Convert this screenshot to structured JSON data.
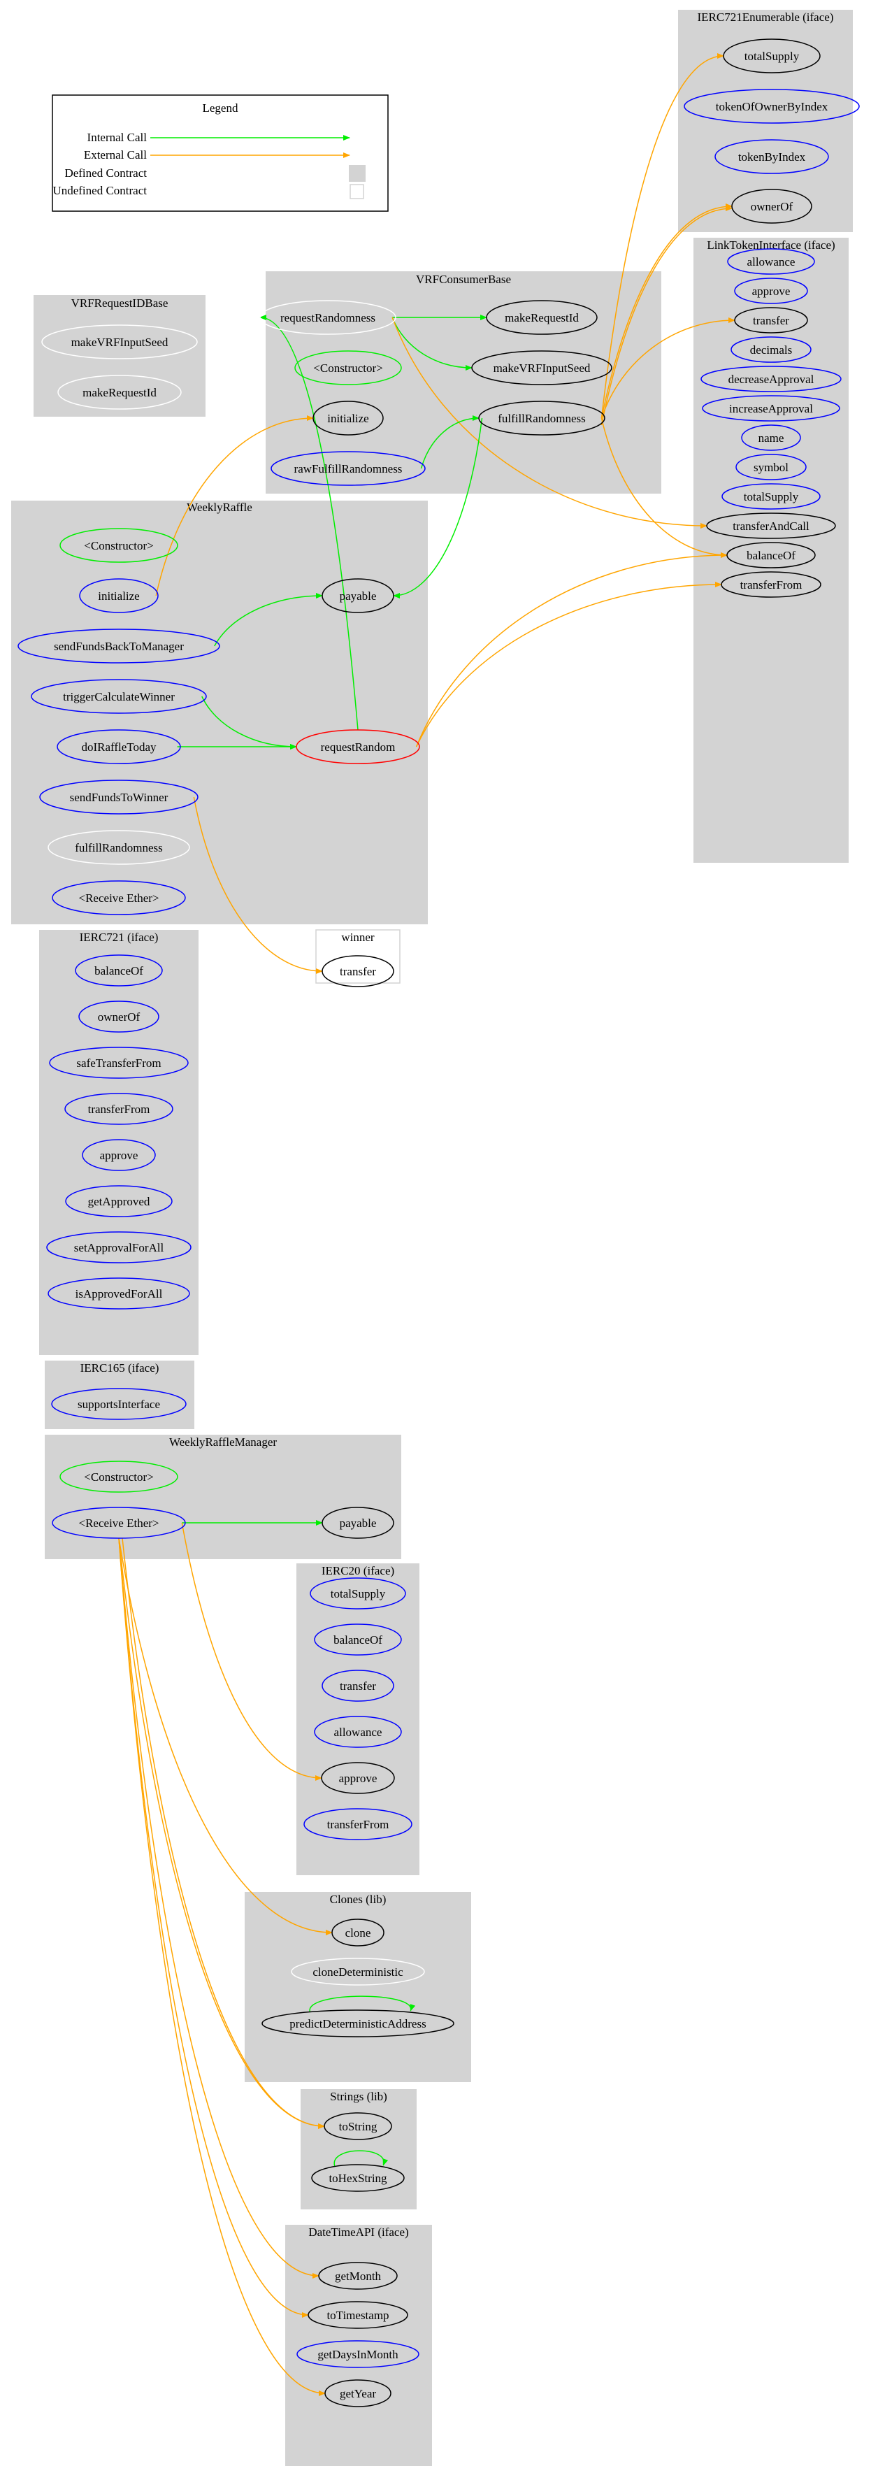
{
  "legend": {
    "title": "Legend",
    "items": [
      {
        "label": "Internal Call",
        "kind": "internal"
      },
      {
        "label": "External Call",
        "kind": "external"
      },
      {
        "label": "Defined Contract",
        "kind": "defined"
      },
      {
        "label": "Undefined Contract",
        "kind": "undefined"
      }
    ]
  },
  "colors": {
    "internal_call": "#00ee00",
    "external_call": "#ffa500",
    "defined_contract_fill": "#d3d3d3",
    "undefined_contract_border": "#d3d3d3",
    "public_function": "#0000ff",
    "constructor": "#00ee00",
    "modifier_red": "#ff0000",
    "internal_function": "#ffffff",
    "called_function": "#000000"
  },
  "clusters": [
    {
      "id": "IERC721Enumerable",
      "label": "IERC721Enumerable  (iface)",
      "defined": true,
      "nodes": [
        {
          "id": "e_totalSupply",
          "label": "totalSupply",
          "color": "#000000"
        },
        {
          "id": "e_tokenOfOwnerByIndex",
          "label": "tokenOfOwnerByIndex",
          "color": "#0000ff"
        },
        {
          "id": "e_tokenByIndex",
          "label": "tokenByIndex",
          "color": "#0000ff"
        },
        {
          "id": "e_ownerOf",
          "label": "ownerOf",
          "color": "#000000"
        }
      ]
    },
    {
      "id": "VRFRequestIDBase",
      "label": "VRFRequestIDBase",
      "defined": true,
      "nodes": [
        {
          "id": "r_makeVRFInputSeed",
          "label": "makeVRFInputSeed",
          "color": "#ffffff"
        },
        {
          "id": "r_makeRequestId",
          "label": "makeRequestId",
          "color": "#ffffff"
        }
      ]
    },
    {
      "id": "VRFConsumerBase",
      "label": "VRFConsumerBase",
      "defined": true,
      "nodes": [
        {
          "id": "v_requestRandomness",
          "label": "requestRandomness",
          "color": "#ffffff"
        },
        {
          "id": "v_makeRequestId",
          "label": "makeRequestId",
          "color": "#000000"
        },
        {
          "id": "v_constructor",
          "label": "<Constructor>",
          "color": "#00ee00"
        },
        {
          "id": "v_makeVRFInputSeed",
          "label": "makeVRFInputSeed",
          "color": "#000000"
        },
        {
          "id": "v_initialize",
          "label": "initialize",
          "color": "#000000"
        },
        {
          "id": "v_fulfillRandomness",
          "label": "fulfillRandomness",
          "color": "#000000"
        },
        {
          "id": "v_rawFulfillRandomness",
          "label": "rawFulfillRandomness",
          "color": "#0000ff"
        }
      ]
    },
    {
      "id": "LinkTokenInterface",
      "label": "LinkTokenInterface  (iface)",
      "defined": true,
      "nodes": [
        {
          "id": "l_allowance",
          "label": "allowance",
          "color": "#0000ff"
        },
        {
          "id": "l_approve",
          "label": "approve",
          "color": "#0000ff"
        },
        {
          "id": "l_transfer",
          "label": "transfer",
          "color": "#000000"
        },
        {
          "id": "l_decimals",
          "label": "decimals",
          "color": "#0000ff"
        },
        {
          "id": "l_decreaseApproval",
          "label": "decreaseApproval",
          "color": "#0000ff"
        },
        {
          "id": "l_increaseApproval",
          "label": "increaseApproval",
          "color": "#0000ff"
        },
        {
          "id": "l_name",
          "label": "name",
          "color": "#0000ff"
        },
        {
          "id": "l_symbol",
          "label": "symbol",
          "color": "#0000ff"
        },
        {
          "id": "l_totalSupply",
          "label": "totalSupply",
          "color": "#0000ff"
        },
        {
          "id": "l_transferAndCall",
          "label": "transferAndCall",
          "color": "#000000"
        },
        {
          "id": "l_balanceOf",
          "label": "balanceOf",
          "color": "#000000"
        },
        {
          "id": "l_transferFrom",
          "label": "transferFrom",
          "color": "#000000"
        }
      ]
    },
    {
      "id": "WeeklyRaffle",
      "label": "WeeklyRaffle",
      "defined": true,
      "nodes": [
        {
          "id": "w_constructor",
          "label": "<Constructor>",
          "color": "#00ee00"
        },
        {
          "id": "w_initialize",
          "label": "initialize",
          "color": "#0000ff"
        },
        {
          "id": "w_payable",
          "label": "payable",
          "color": "#000000"
        },
        {
          "id": "w_sendFundsBackToManager",
          "label": "sendFundsBackToManager",
          "color": "#0000ff"
        },
        {
          "id": "w_triggerCalculateWinner",
          "label": "triggerCalculateWinner",
          "color": "#0000ff"
        },
        {
          "id": "w_doIRaffleToday",
          "label": "doIRaffleToday",
          "color": "#0000ff"
        },
        {
          "id": "w_requestRandom",
          "label": "requestRandom",
          "color": "#ff0000"
        },
        {
          "id": "w_sendFundsToWinner",
          "label": "sendFundsToWinner",
          "color": "#0000ff"
        },
        {
          "id": "w_fulfillRandomness",
          "label": "fulfillRandomness",
          "color": "#ffffff"
        },
        {
          "id": "w_receiveEther",
          "label": "<Receive Ether>",
          "color": "#0000ff"
        }
      ]
    },
    {
      "id": "winner",
      "label": "winner",
      "defined": false,
      "nodes": [
        {
          "id": "x_transfer",
          "label": "transfer",
          "color": "#000000"
        }
      ]
    },
    {
      "id": "IERC721",
      "label": "IERC721  (iface)",
      "defined": true,
      "nodes": [
        {
          "id": "i_balanceOf",
          "label": "balanceOf",
          "color": "#0000ff"
        },
        {
          "id": "i_ownerOf",
          "label": "ownerOf",
          "color": "#0000ff"
        },
        {
          "id": "i_safeTransferFrom",
          "label": "safeTransferFrom",
          "color": "#0000ff"
        },
        {
          "id": "i_transferFrom",
          "label": "transferFrom",
          "color": "#0000ff"
        },
        {
          "id": "i_approve",
          "label": "approve",
          "color": "#0000ff"
        },
        {
          "id": "i_getApproved",
          "label": "getApproved",
          "color": "#0000ff"
        },
        {
          "id": "i_setApprovalForAll",
          "label": "setApprovalForAll",
          "color": "#0000ff"
        },
        {
          "id": "i_isApprovedForAll",
          "label": "isApprovedForAll",
          "color": "#0000ff"
        }
      ]
    },
    {
      "id": "IERC165",
      "label": "IERC165  (iface)",
      "defined": true,
      "nodes": [
        {
          "id": "s_supportsInterface",
          "label": "supportsInterface",
          "color": "#0000ff"
        }
      ]
    },
    {
      "id": "WeeklyRaffleManager",
      "label": "WeeklyRaffleManager",
      "defined": true,
      "nodes": [
        {
          "id": "m_constructor",
          "label": "<Constructor>",
          "color": "#00ee00"
        },
        {
          "id": "m_receiveEther",
          "label": "<Receive Ether>",
          "color": "#0000ff"
        },
        {
          "id": "m_payable",
          "label": "payable",
          "color": "#000000"
        }
      ]
    },
    {
      "id": "IERC20",
      "label": "IERC20  (iface)",
      "defined": true,
      "nodes": [
        {
          "id": "t_totalSupply",
          "label": "totalSupply",
          "color": "#0000ff"
        },
        {
          "id": "t_balanceOf",
          "label": "balanceOf",
          "color": "#0000ff"
        },
        {
          "id": "t_transfer",
          "label": "transfer",
          "color": "#0000ff"
        },
        {
          "id": "t_allowance",
          "label": "allowance",
          "color": "#0000ff"
        },
        {
          "id": "t_approve",
          "label": "approve",
          "color": "#000000"
        },
        {
          "id": "t_transferFrom",
          "label": "transferFrom",
          "color": "#0000ff"
        }
      ]
    },
    {
      "id": "Clones",
      "label": "Clones  (lib)",
      "defined": true,
      "nodes": [
        {
          "id": "c_clone",
          "label": "clone",
          "color": "#000000"
        },
        {
          "id": "c_cloneDeterministic",
          "label": "cloneDeterministic",
          "color": "#ffffff"
        },
        {
          "id": "c_predictDeterministicAddress",
          "label": "predictDeterministicAddress",
          "color": "#000000"
        }
      ]
    },
    {
      "id": "Strings",
      "label": "Strings  (lib)",
      "defined": true,
      "nodes": [
        {
          "id": "g_toString",
          "label": "toString",
          "color": "#000000"
        },
        {
          "id": "g_toHexString",
          "label": "toHexString",
          "color": "#000000"
        }
      ]
    },
    {
      "id": "DateTimeAPI",
      "label": "DateTimeAPI  (iface)",
      "defined": true,
      "nodes": [
        {
          "id": "d_getMonth",
          "label": "getMonth",
          "color": "#000000"
        },
        {
          "id": "d_toTimestamp",
          "label": "toTimestamp",
          "color": "#000000"
        },
        {
          "id": "d_getDaysInMonth",
          "label": "getDaysInMonth",
          "color": "#0000ff"
        },
        {
          "id": "d_getYear",
          "label": "getYear",
          "color": "#000000"
        }
      ]
    }
  ],
  "edges": [
    {
      "from": "v_requestRandomness",
      "to": "v_makeRequestId",
      "type": "internal"
    },
    {
      "from": "v_requestRandomness",
      "to": "v_makeVRFInputSeed",
      "type": "internal"
    },
    {
      "from": "v_requestRandomness",
      "to": "l_transferAndCall",
      "type": "external"
    },
    {
      "from": "v_rawFulfillRandomness",
      "to": "v_fulfillRandomness",
      "type": "internal"
    },
    {
      "from": "v_fulfillRandomness",
      "to": "w_payable",
      "type": "internal"
    },
    {
      "from": "v_fulfillRandomness",
      "to": "e_totalSupply",
      "type": "external"
    },
    {
      "from": "v_fulfillRandomness",
      "to": "e_ownerOf",
      "type": "external"
    },
    {
      "from": "v_fulfillRandomness",
      "to": "e_ownerOf",
      "type": "external"
    },
    {
      "from": "v_fulfillRandomness",
      "to": "l_transfer",
      "type": "external"
    },
    {
      "from": "v_fulfillRandomness",
      "to": "l_balanceOf",
      "type": "external"
    },
    {
      "from": "w_initialize",
      "to": "v_initialize",
      "type": "external"
    },
    {
      "from": "w_sendFundsBackToManager",
      "to": "w_payable",
      "type": "internal"
    },
    {
      "from": "w_triggerCalculateWinner",
      "to": "w_requestRandom",
      "type": "internal"
    },
    {
      "from": "w_doIRaffleToday",
      "to": "w_requestRandom",
      "type": "internal"
    },
    {
      "from": "w_requestRandom",
      "to": "v_requestRandomness",
      "type": "internal"
    },
    {
      "from": "w_requestRandom",
      "to": "l_balanceOf",
      "type": "external"
    },
    {
      "from": "w_requestRandom",
      "to": "l_transferFrom",
      "type": "external"
    },
    {
      "from": "w_sendFundsToWinner",
      "to": "x_transfer",
      "type": "external"
    },
    {
      "from": "m_receiveEther",
      "to": "m_payable",
      "type": "internal"
    },
    {
      "from": "m_receiveEther",
      "to": "t_approve",
      "type": "external"
    },
    {
      "from": "m_receiveEther",
      "to": "c_clone",
      "type": "external"
    },
    {
      "from": "m_receiveEther",
      "to": "g_toString",
      "type": "external"
    },
    {
      "from": "m_receiveEther",
      "to": "g_toString",
      "type": "external"
    },
    {
      "from": "m_receiveEther",
      "to": "d_getMonth",
      "type": "external"
    },
    {
      "from": "m_receiveEther",
      "to": "d_toTimestamp",
      "type": "external"
    },
    {
      "from": "m_receiveEther",
      "to": "d_getYear",
      "type": "external"
    },
    {
      "from": "c_predictDeterministicAddress",
      "to": "c_predictDeterministicAddress",
      "type": "internal"
    },
    {
      "from": "g_toHexString",
      "to": "g_toHexString",
      "type": "internal"
    }
  ]
}
